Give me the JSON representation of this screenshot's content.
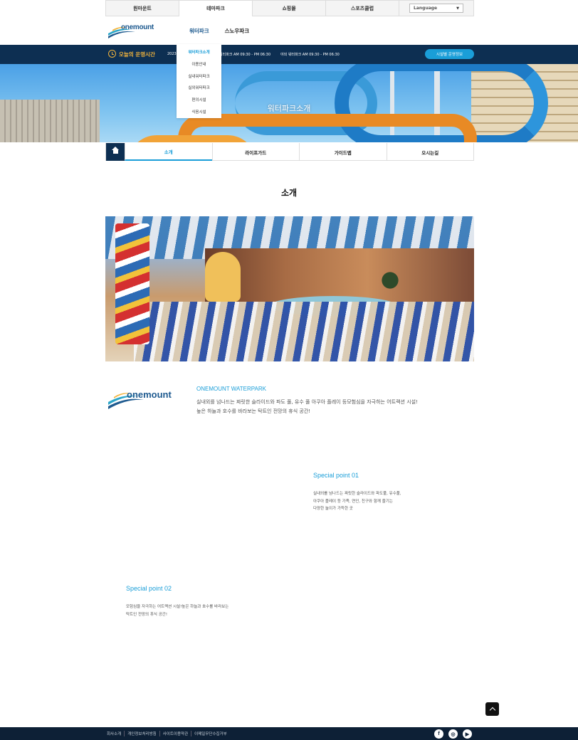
{
  "top_tabs": [
    {
      "label": "원마운트"
    },
    {
      "label": "테마파크"
    },
    {
      "label": "쇼핑몰"
    },
    {
      "label": "스포츠클럽"
    }
  ],
  "language": {
    "selected": "Language"
  },
  "logo": {
    "text": "onemount"
  },
  "main_nav": [
    {
      "label": "워터파크"
    },
    {
      "label": "스노우파크"
    }
  ],
  "hours": {
    "title": "오늘의 운영시간",
    "date": "2023.",
    "water": "워터파크   AM 09:30 - PM 06:30",
    "night": "야외 워터파크   AM 09:30 - PM 06:30",
    "button": "시설별 운영정보"
  },
  "dropdown": [
    {
      "label": "워터파크소개"
    },
    {
      "label": "이용안내"
    },
    {
      "label": "실내워터파크"
    },
    {
      "label": "실외워터파크"
    },
    {
      "label": "편의시설"
    },
    {
      "label": "식음시설"
    }
  ],
  "hero": {
    "title": "워터파크소개"
  },
  "sub_tabs": [
    {
      "label": "소개"
    },
    {
      "label": "라이프가드"
    },
    {
      "label": "가이드맵"
    },
    {
      "label": "오시는길"
    }
  ],
  "section": {
    "title": "소개"
  },
  "brand": {
    "title": "ONEMOUNT WATERPARK",
    "desc_line1": "실내외를 넘나드는 짜릿한 슬라이드와 파도 풀, 유수 풀 아쿠아 플레이 등모험심을 자극하는 어트랙션 시설!",
    "desc_line2": "높은 하늘과 호수를 바라보는 탁트인 전망의 휴식 공간!"
  },
  "special_points": [
    {
      "title": "Special point 01",
      "lines": [
        "실내외를 넘나드는 짜릿한 슬라이드와 파도풀, 유수풀,",
        "아쿠아 플레이 등 가족, 연인, 친구와 함께 즐기는",
        "다양한 놀이가 가득한 곳"
      ]
    },
    {
      "title": "Special point 02",
      "lines": [
        "모험심을 자극하는 어트랙션 시설!높은 하늘과 호수를 바라보는",
        "탁트인 전망의 휴식 공간!"
      ]
    }
  ],
  "footer": {
    "links": [
      {
        "label": "회사소개"
      },
      {
        "label": "개인정보처리방침"
      },
      {
        "label": "사이트이용약관"
      },
      {
        "label": "이메일무단수집거부"
      }
    ]
  },
  "social": [
    {
      "icon": "facebook-icon",
      "glyph": "f"
    },
    {
      "icon": "instagram-icon",
      "glyph": "◎"
    },
    {
      "icon": "youtube-icon",
      "glyph": "▶"
    }
  ],
  "colors": {
    "navy": "#0d2f52",
    "accent_blue": "#1a9ed8",
    "clock_orange": "#f2b43c",
    "footer": "#0d2036"
  }
}
